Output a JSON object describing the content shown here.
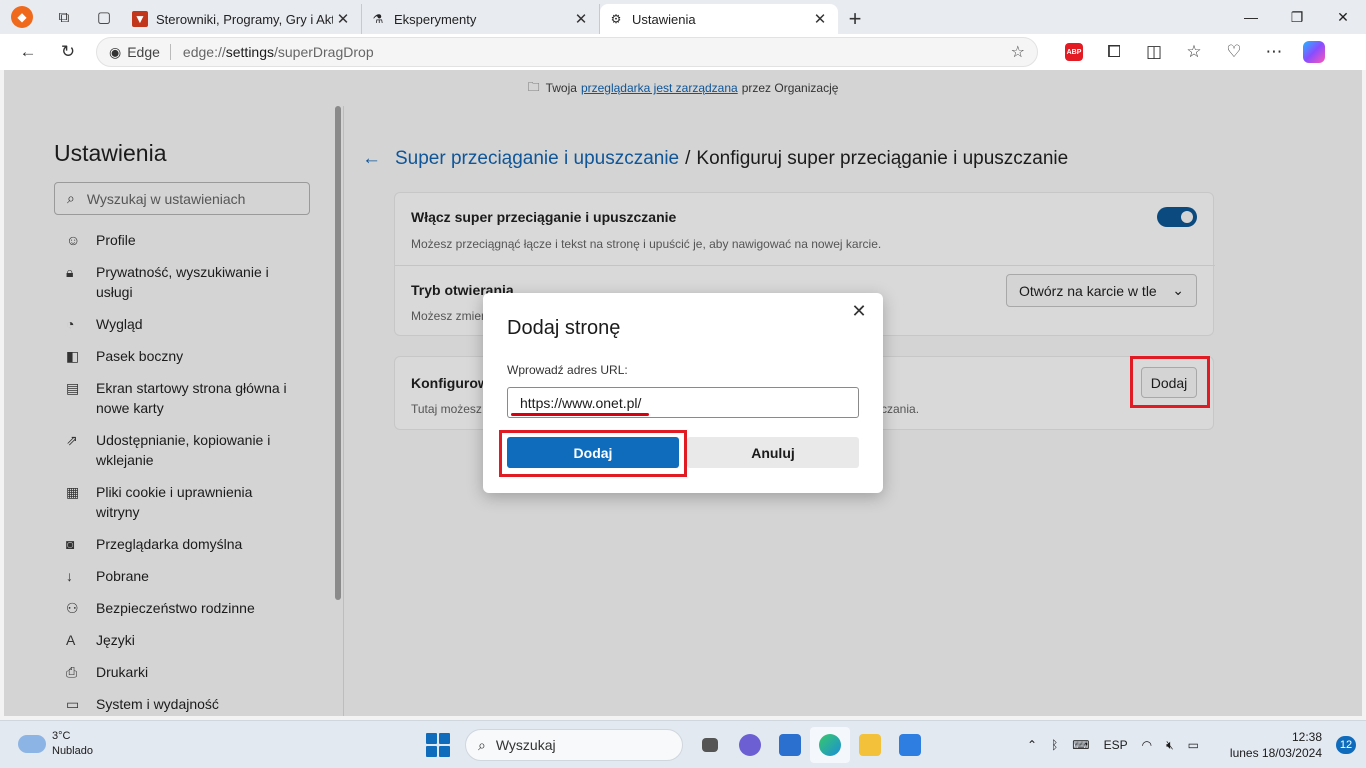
{
  "browser": {
    "tabs": [
      {
        "title": "Sterowniki, Programy, Gry i Aktua",
        "favicon": "shield-icon",
        "active": false
      },
      {
        "title": "Eksperymenty",
        "favicon": "flask-icon",
        "active": false
      },
      {
        "title": "Ustawienia",
        "favicon": "gear-icon",
        "active": true
      }
    ],
    "address": {
      "brand": "Edge",
      "url_scheme": "edge://",
      "url_host": "settings",
      "url_path": "/superDragDrop"
    }
  },
  "banner": {
    "prefix": "Twoja",
    "link": "przeglądarka jest zarządzana",
    "suffix": "przez Organizację"
  },
  "sidebar": {
    "title": "Ustawienia",
    "search_placeholder": "Wyszukaj w ustawieniach",
    "items": [
      {
        "label": "Profile",
        "icon": "profile-icon"
      },
      {
        "label": "Prywatność, wyszukiwanie i usługi",
        "icon": "lock-icon"
      },
      {
        "label": "Wygląd",
        "icon": "palette-icon"
      },
      {
        "label": "Pasek boczny",
        "icon": "sidebar-icon"
      },
      {
        "label": "Ekran startowy strona główna i nowe karty",
        "icon": "home-icon"
      },
      {
        "label": "Udostępnianie, kopiowanie i wklejanie",
        "icon": "share-icon"
      },
      {
        "label": "Pliki cookie i uprawnienia witryny",
        "icon": "cookie-icon"
      },
      {
        "label": "Przeglądarka domyślna",
        "icon": "browser-icon"
      },
      {
        "label": "Pobrane",
        "icon": "download-icon"
      },
      {
        "label": "Bezpieczeństwo rodzinne",
        "icon": "family-icon"
      },
      {
        "label": "Języki",
        "icon": "language-icon"
      },
      {
        "label": "Drukarki",
        "icon": "printer-icon"
      },
      {
        "label": "System i wydajność",
        "icon": "laptop-icon"
      }
    ]
  },
  "main": {
    "breadcrumb_link": "Super przeciąganie i upuszczanie",
    "breadcrumb_sep": "/",
    "breadcrumb_current": "Konfiguruj super przeciąganie i upuszczanie",
    "enable_title": "Włącz super przeciąganie i upuszczanie",
    "enable_desc": "Możesz przeciągnąć łącze i tekst na stronę i upuścić je, aby nawigować na nowej karcie.",
    "enable_on": true,
    "mode_title": "Tryb otwierania",
    "mode_desc": "Możesz zmien",
    "mode_value": "Otwórz na karcie w tle",
    "config_title": "Konfigurow",
    "config_desc": "Tutaj możesz",
    "config_desc_tail": "zczania.",
    "add_label": "Dodaj"
  },
  "dialog": {
    "title": "Dodaj stronę",
    "label": "Wprowadź adres URL:",
    "url_value": "https://www.onet.pl/",
    "primary": "Dodaj",
    "secondary": "Anuluj"
  },
  "taskbar": {
    "weather_temp": "3°C",
    "weather_desc": "Nublado",
    "search": "Wyszukaj",
    "lang": "ESP",
    "time": "12:38",
    "date": "lunes 18/03/2024",
    "notifications": "12"
  },
  "colors": {
    "accent": "#0f6cbd",
    "highlight": "#e01b24"
  }
}
